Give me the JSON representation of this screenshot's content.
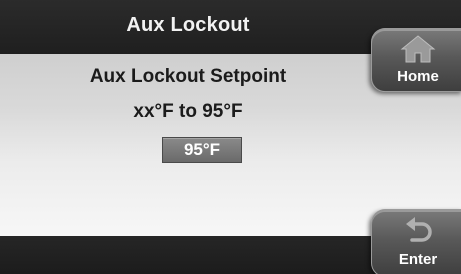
{
  "header": {
    "title": "Aux Lockout"
  },
  "main": {
    "setpoint_label": "Aux Lockout Setpoint",
    "range_text": "xx°F to 95°F",
    "current_value": "95°F"
  },
  "buttons": {
    "home": {
      "label": "Home",
      "icon": "home-icon"
    },
    "enter": {
      "label": "Enter",
      "icon": "return-arrow-icon"
    }
  },
  "colors": {
    "title_bar": "#1f1f1f",
    "content_bg": "#e6e6e6",
    "value_box": "#7a7a7a",
    "button": "#595959"
  }
}
